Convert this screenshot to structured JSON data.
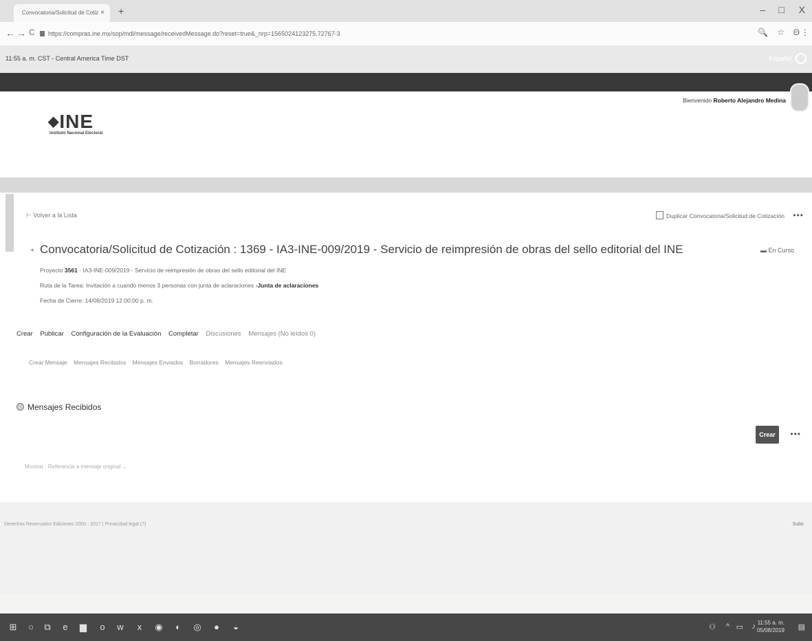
{
  "browser": {
    "tab_title": "Convocatoria/Solicitud de Cotiz",
    "url": "https://compras.ine.mx/sop/mdl/message/receivedMessage.do?reset=true&_nrp=1565024123275.72767-3",
    "controls": {
      "back": "←",
      "forward": "→",
      "reload": "C",
      "new_tab": "+",
      "close_tab": "×",
      "minimize": "–",
      "maximize": "□",
      "close": "X"
    }
  },
  "timebar": {
    "time": "11:55 a. m. CST - Central America Time DST",
    "right_label": "Español"
  },
  "header": {
    "welcome_prefix": "Bienvenido",
    "user_name": "Roberto Alejandro Medina",
    "logo_text": "INE",
    "logo_subtitle": "Instituto Nacional Electoral"
  },
  "page": {
    "back_link": "Volver a la Lista",
    "duplicate_action": "Duplicar Convocatoria/Solicitud de Cotización",
    "title": "Convocatoria/Solicitud de Cotización : 1369 - IA3-INE-009/2019 - Servicio de reimpresión de obras del sello editorial del INE",
    "status": "En Curso",
    "project_label": "Proyecto",
    "project_number": "3561",
    "project_desc": "- IA3-INE-009/2019 - Servicio de reimpresión de obras del sello editorial del INE",
    "route_label": "Ruta de la Tarea: Invitación a cuando menos 3 personas con junta de aclaraciones",
    "route_current": "Junta de aclaraciones",
    "close_date": "Fecha de Cierre: 14/08/2019 12:00:00 p. m."
  },
  "tabs_main": [
    {
      "label": "Crear"
    },
    {
      "label": "Publicar"
    },
    {
      "label": "Configuración de la Evaluación"
    },
    {
      "label": "Completar"
    },
    {
      "label": "Discusiones"
    },
    {
      "label": "Mensajes (No leídos 0)"
    }
  ],
  "tabs_messages": [
    {
      "label": "Crear Mensaje"
    },
    {
      "label": "Mensajes Recibidos"
    },
    {
      "label": "Mensajes Enviados"
    },
    {
      "label": "Borradores"
    },
    {
      "label": "Mensajes Reenviados"
    }
  ],
  "messages": {
    "section_title": "Mensajes Recibidos",
    "create_button": "Crear",
    "more": "•••",
    "filter_text": "Mostrar : Referencia a mensaje original"
  },
  "footer": {
    "copyright": "Derechos Reservados Ediciones 2000 - 2017 | Privacidad legal (?)",
    "scroll_top": "Subir"
  },
  "taskbar": {
    "time": "11:55 a. m.",
    "date": "05/08/2019"
  }
}
